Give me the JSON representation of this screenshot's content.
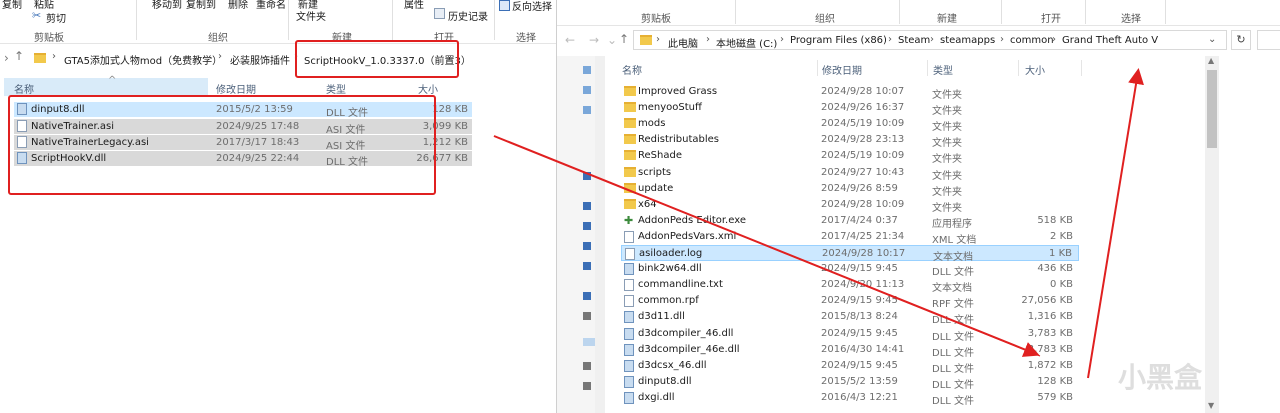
{
  "left": {
    "ribbon": {
      "copy": "复制",
      "paste": "粘贴",
      "cut": "剪切",
      "clipboard_group": "剪贴板",
      "move_to": "移动到",
      "copy_to": "复制到",
      "delete": "删除",
      "rename": "重命名",
      "organize_group": "组织",
      "new_folder_line1": "新建",
      "new_folder_line2": "文件夹",
      "new_group": "新建",
      "properties": "属性",
      "history": "历史记录",
      "open_group": "打开",
      "reverse_select": "反向选择",
      "select_group": "选择"
    },
    "breadcrumb": [
      "GTA5添加式人物mod（免费教学）",
      "必装服饰插件",
      "ScriptHookV_1.0.3337.0（前置3）"
    ],
    "columns": {
      "name": "名称",
      "date": "修改日期",
      "type": "类型",
      "size": "大小"
    },
    "files": [
      {
        "icon": "dll-file-icon",
        "name": "dinput8.dll",
        "date": "2015/5/2 13:59",
        "type": "DLL 文件",
        "size": "128 KB"
      },
      {
        "icon": "file-icon",
        "name": "NativeTrainer.asi",
        "date": "2024/9/25 17:48",
        "type": "ASI 文件",
        "size": "3,099 KB"
      },
      {
        "icon": "file-icon",
        "name": "NativeTrainerLegacy.asi",
        "date": "2017/3/17 18:43",
        "type": "ASI 文件",
        "size": "1,212 KB"
      },
      {
        "icon": "dll-file-icon",
        "name": "ScriptHookV.dll",
        "date": "2024/9/25 22:44",
        "type": "DLL 文件",
        "size": "26,677 KB"
      }
    ]
  },
  "right": {
    "ribbon": {
      "clipboard_group": "剪贴板",
      "organize_group": "组织",
      "new_group": "新建",
      "open_group": "打开",
      "select_group": "选择"
    },
    "breadcrumb": [
      "此电脑",
      "本地磁盘 (C:)",
      "Program Files (x86)",
      "Steam",
      "steamapps",
      "common",
      "Grand Theft Auto V"
    ],
    "columns": {
      "name": "名称",
      "date": "修改日期",
      "type": "类型",
      "size": "大小"
    },
    "files": [
      {
        "icon": "folder-icon",
        "name": "Improved Grass",
        "date": "2024/9/28 10:07",
        "type": "文件夹",
        "size": ""
      },
      {
        "icon": "folder-icon",
        "name": "menyooStuff",
        "date": "2024/9/26 16:37",
        "type": "文件夹",
        "size": ""
      },
      {
        "icon": "folder-icon",
        "name": "mods",
        "date": "2024/5/19 10:09",
        "type": "文件夹",
        "size": ""
      },
      {
        "icon": "folder-icon",
        "name": "Redistributables",
        "date": "2024/9/28 23:13",
        "type": "文件夹",
        "size": ""
      },
      {
        "icon": "folder-icon",
        "name": "ReShade",
        "date": "2024/5/19 10:09",
        "type": "文件夹",
        "size": ""
      },
      {
        "icon": "folder-icon",
        "name": "scripts",
        "date": "2024/9/27 10:43",
        "type": "文件夹",
        "size": ""
      },
      {
        "icon": "folder-icon",
        "name": "update",
        "date": "2024/9/26 8:59",
        "type": "文件夹",
        "size": ""
      },
      {
        "icon": "folder-icon",
        "name": "x64",
        "date": "2024/9/28 10:09",
        "type": "文件夹",
        "size": ""
      },
      {
        "icon": "exe-icon",
        "name": "AddonPeds Editor.exe",
        "date": "2017/4/24 0:37",
        "type": "应用程序",
        "size": "518 KB"
      },
      {
        "icon": "file-icon",
        "name": "AddonPedsVars.xml",
        "date": "2017/4/25 21:34",
        "type": "XML 文档",
        "size": "2 KB"
      },
      {
        "icon": "file-icon",
        "name": "asiloader.log",
        "date": "2024/9/28 10:17",
        "type": "文本文档",
        "size": "1 KB"
      },
      {
        "icon": "dll-file-icon",
        "name": "bink2w64.dll",
        "date": "2024/9/15 9:45",
        "type": "DLL 文件",
        "size": "436 KB"
      },
      {
        "icon": "file-icon",
        "name": "commandline.txt",
        "date": "2024/9/20 11:13",
        "type": "文本文档",
        "size": "0 KB"
      },
      {
        "icon": "file-icon",
        "name": "common.rpf",
        "date": "2024/9/15 9:45",
        "type": "RPF 文件",
        "size": "27,056 KB"
      },
      {
        "icon": "dll-file-icon",
        "name": "d3d11.dll",
        "date": "2015/8/13 8:24",
        "type": "DLL 文件",
        "size": "1,316 KB"
      },
      {
        "icon": "dll-file-icon",
        "name": "d3dcompiler_46.dll",
        "date": "2024/9/15 9:45",
        "type": "DLL 文件",
        "size": "3,783 KB"
      },
      {
        "icon": "dll-file-icon",
        "name": "d3dcompiler_46e.dll",
        "date": "2016/4/30 14:41",
        "type": "DLL 文件",
        "size": "3,783 KB"
      },
      {
        "icon": "dll-file-icon",
        "name": "d3dcsx_46.dll",
        "date": "2024/9/15 9:45",
        "type": "DLL 文件",
        "size": "1,872 KB"
      },
      {
        "icon": "dll-file-icon",
        "name": "dinput8.dll",
        "date": "2015/5/2 13:59",
        "type": "DLL 文件",
        "size": "128 KB"
      },
      {
        "icon": "dll-file-icon",
        "name": "dxgi.dll",
        "date": "2016/4/3 12:21",
        "type": "DLL 文件",
        "size": "579 KB"
      }
    ]
  },
  "watermark": "小黑盒",
  "colors": {
    "selection": "#cce8ff",
    "annotation_red": "#e02020",
    "folder": "#f2c94c"
  }
}
